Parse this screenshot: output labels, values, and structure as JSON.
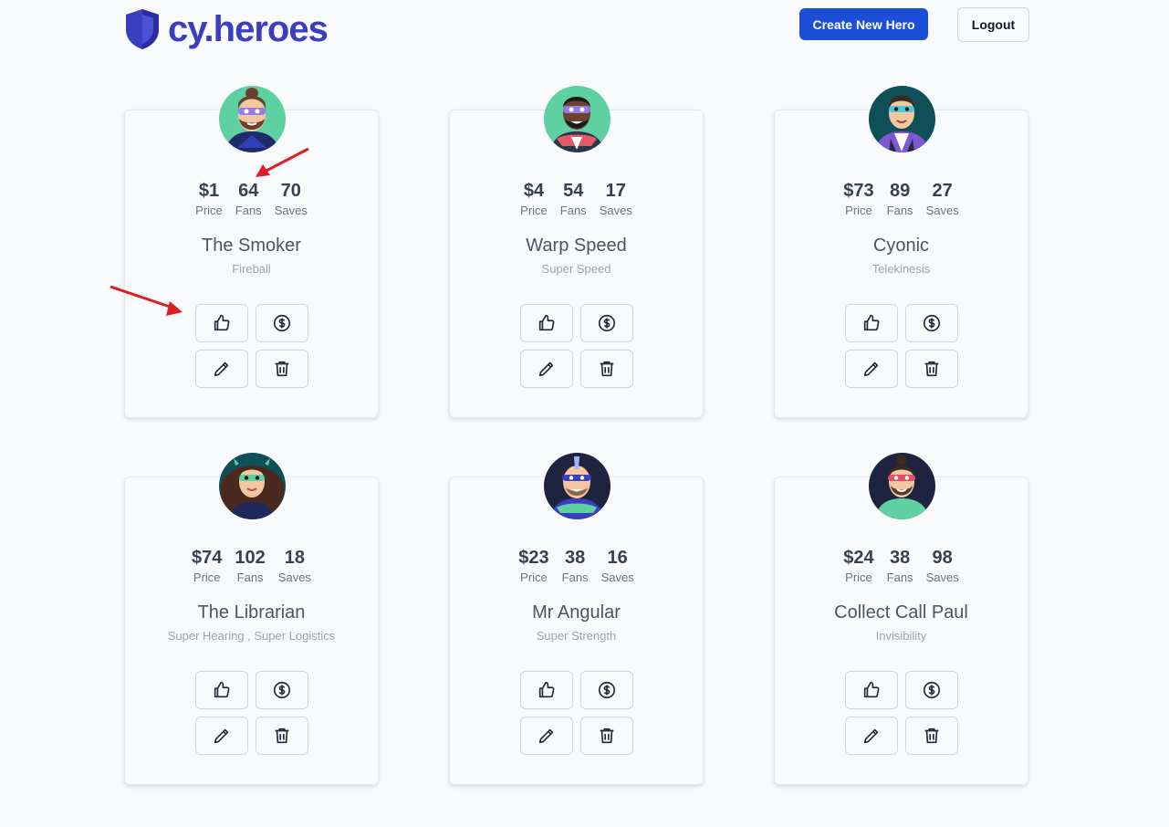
{
  "app": {
    "logo_text": "cy.heroes",
    "brand_color": "#3b3fbf",
    "accent_color": "#1d4ed8"
  },
  "header": {
    "create_label": "Create New Hero",
    "logout_label": "Logout"
  },
  "labels": {
    "price": "Price",
    "fans": "Fans",
    "saves": "Saves"
  },
  "heroes": [
    {
      "price": "$1",
      "fans": "64",
      "saves": "70",
      "name": "The Smoker",
      "powers": "Fireball"
    },
    {
      "price": "$4",
      "fans": "54",
      "saves": "17",
      "name": "Warp Speed",
      "powers": "Super Speed"
    },
    {
      "price": "$73",
      "fans": "89",
      "saves": "27",
      "name": "Cyonic",
      "powers": "Telekinesis"
    },
    {
      "price": "$74",
      "fans": "102",
      "saves": "18",
      "name": "The Librarian",
      "powers": "Super Hearing ,  Super Logistics"
    },
    {
      "price": "$23",
      "fans": "38",
      "saves": "16",
      "name": "Mr Angular",
      "powers": "Super Strength"
    },
    {
      "price": "$24",
      "fans": "38",
      "saves": "98",
      "name": "Collect Call Paul",
      "powers": "Invisibility"
    }
  ],
  "icons": {
    "like": "thumbs-up-icon",
    "buy": "dollar-icon",
    "edit": "pencil-icon",
    "delete": "trash-icon"
  },
  "annotation_color": "#e11d24"
}
